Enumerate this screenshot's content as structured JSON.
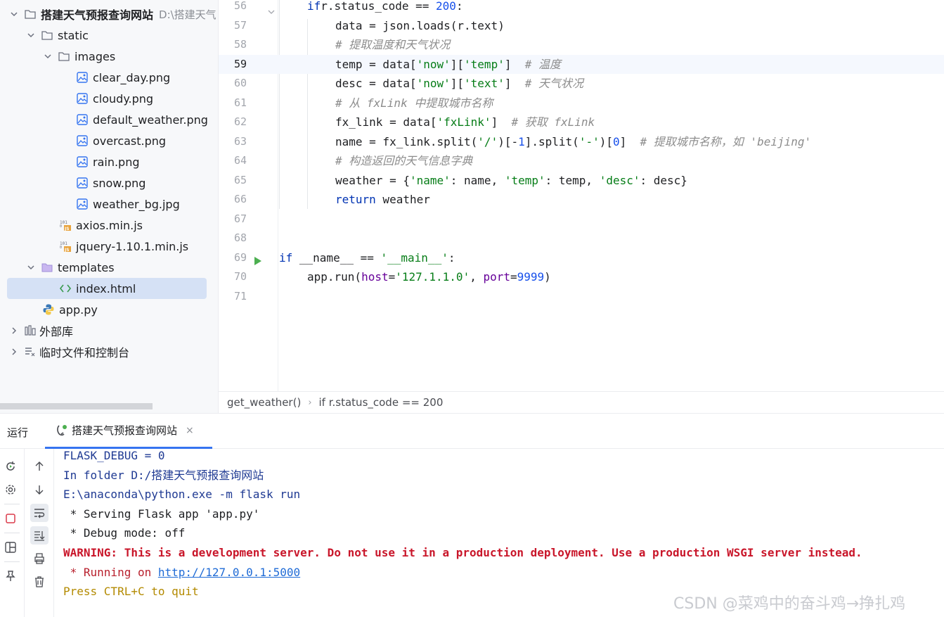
{
  "tree": {
    "project_name": "搭建天气预报查询网站",
    "project_path": "D:\\搭建天气",
    "items": [
      {
        "label": "static"
      },
      {
        "label": "images"
      },
      {
        "label": "clear_day.png"
      },
      {
        "label": "cloudy.png"
      },
      {
        "label": "default_weather.png"
      },
      {
        "label": "overcast.png"
      },
      {
        "label": "rain.png"
      },
      {
        "label": "snow.png"
      },
      {
        "label": "weather_bg.jpg"
      },
      {
        "label": "axios.min.js"
      },
      {
        "label": "jquery-1.10.1.min.js"
      },
      {
        "label": "templates"
      },
      {
        "label": "index.html"
      },
      {
        "label": "app.py"
      },
      {
        "label": "外部库"
      },
      {
        "label": "临时文件和控制台"
      }
    ]
  },
  "editor": {
    "current_line": "59",
    "lines": [
      {
        "num": "56",
        "tokens": [
          [
            "kw",
            "if"
          ],
          [
            "",
            "r.status_code == "
          ],
          [
            "num",
            "200"
          ],
          [
            "",
            ":"
          ]
        ]
      },
      {
        "num": "57",
        "tokens": [
          [
            "",
            "data = json.loads(r.text)"
          ]
        ]
      },
      {
        "num": "58",
        "tokens": [
          [
            "cmt",
            "# 提取温度和天气状况"
          ]
        ]
      },
      {
        "num": "59",
        "tokens": [
          [
            "",
            "temp = data["
          ],
          [
            "str",
            "'now'"
          ],
          [
            "",
            "]["
          ],
          [
            "str",
            "'temp'"
          ],
          [
            "",
            "]  "
          ],
          [
            "cmt",
            "# 温度"
          ]
        ]
      },
      {
        "num": "60",
        "tokens": [
          [
            "",
            "desc = data["
          ],
          [
            "str",
            "'now'"
          ],
          [
            "",
            "]["
          ],
          [
            "str",
            "'text'"
          ],
          [
            "",
            "]  "
          ],
          [
            "cmt",
            "# 天气状况"
          ]
        ]
      },
      {
        "num": "61",
        "tokens": [
          [
            "cmt",
            "# 从 fxLink 中提取城市名称"
          ]
        ]
      },
      {
        "num": "62",
        "tokens": [
          [
            "",
            "fx_link = data["
          ],
          [
            "str",
            "'fxLink'"
          ],
          [
            "",
            "]  "
          ],
          [
            "cmt",
            "# 获取 fxLink"
          ]
        ]
      },
      {
        "num": "63",
        "tokens": [
          [
            "",
            "name = fx_link.split("
          ],
          [
            "str",
            "'/'"
          ],
          [
            "",
            ")[-"
          ],
          [
            "num",
            "1"
          ],
          [
            "",
            "].split("
          ],
          [
            "str",
            "'-'"
          ],
          [
            "",
            ")["
          ],
          [
            "num",
            "0"
          ],
          [
            "",
            "]  "
          ],
          [
            "cmt",
            "# 提取城市名称，如 'beijing'"
          ]
        ]
      },
      {
        "num": "64",
        "tokens": [
          [
            "cmt",
            "# 构造返回的天气信息字典"
          ]
        ]
      },
      {
        "num": "65",
        "tokens": [
          [
            "",
            "weather = {"
          ],
          [
            "str",
            "'name'"
          ],
          [
            "",
            ": name, "
          ],
          [
            "str",
            "'temp'"
          ],
          [
            "",
            ": temp, "
          ],
          [
            "str",
            "'desc'"
          ],
          [
            "",
            ": desc}"
          ]
        ]
      },
      {
        "num": "66",
        "tokens": [
          [
            "kw",
            "return"
          ],
          [
            "",
            " weather"
          ]
        ]
      },
      {
        "num": "67",
        "tokens": []
      },
      {
        "num": "68",
        "tokens": []
      },
      {
        "num": "69",
        "tokens": [
          [
            "kw",
            "if"
          ],
          [
            "",
            " __name__ == "
          ],
          [
            "str",
            "'__main__'"
          ],
          [
            "",
            ":"
          ]
        ]
      },
      {
        "num": "70",
        "tokens": [
          [
            "",
            "app.run("
          ],
          [
            "param",
            "host"
          ],
          [
            "",
            "="
          ],
          [
            "str",
            "'127.1.1.0'"
          ],
          [
            "",
            ", "
          ],
          [
            "param",
            "port"
          ],
          [
            "",
            "="
          ],
          [
            "num",
            "9999"
          ],
          [
            "",
            ")"
          ]
        ]
      },
      {
        "num": "71",
        "tokens": []
      }
    ]
  },
  "breadcrumb": {
    "function": "get_weather()",
    "separator": "›",
    "condition": "if r.status_code == 200"
  },
  "run": {
    "title": "运行",
    "tab_label": "搭建天气预报查询网站",
    "tab_close": "×",
    "console": [
      {
        "cls": "c-blue",
        "text": "FLASK_DEBUG = 0"
      },
      {
        "cls": "c-blue",
        "text": "In folder D:/搭建天气预报查询网站"
      },
      {
        "cls": "c-blue",
        "text": "E:\\anaconda\\python.exe -m flask run"
      },
      {
        "cls": "",
        "text": " * Serving Flask app 'app.py'"
      },
      {
        "cls": "",
        "text": " * Debug mode: off"
      },
      {
        "cls": "c-warn",
        "text": "WARNING: This is a development server. Do not use it in a production deployment. Use a production WSGI server instead."
      },
      {
        "cls": "running",
        "prefix": " * Running on ",
        "link": "http://127.0.0.1:5000"
      },
      {
        "cls": "c-gold",
        "text": "Press CTRL+C to quit"
      }
    ]
  },
  "watermark": "CSDN @菜鸡中的奋斗鸡→挣扎鸡",
  "colors": {
    "accent": "#3574f0",
    "keyword": "#0033b3",
    "string": "#067d17",
    "number": "#1750eb",
    "comment": "#8c8c8c",
    "warning": "#c9162a"
  }
}
